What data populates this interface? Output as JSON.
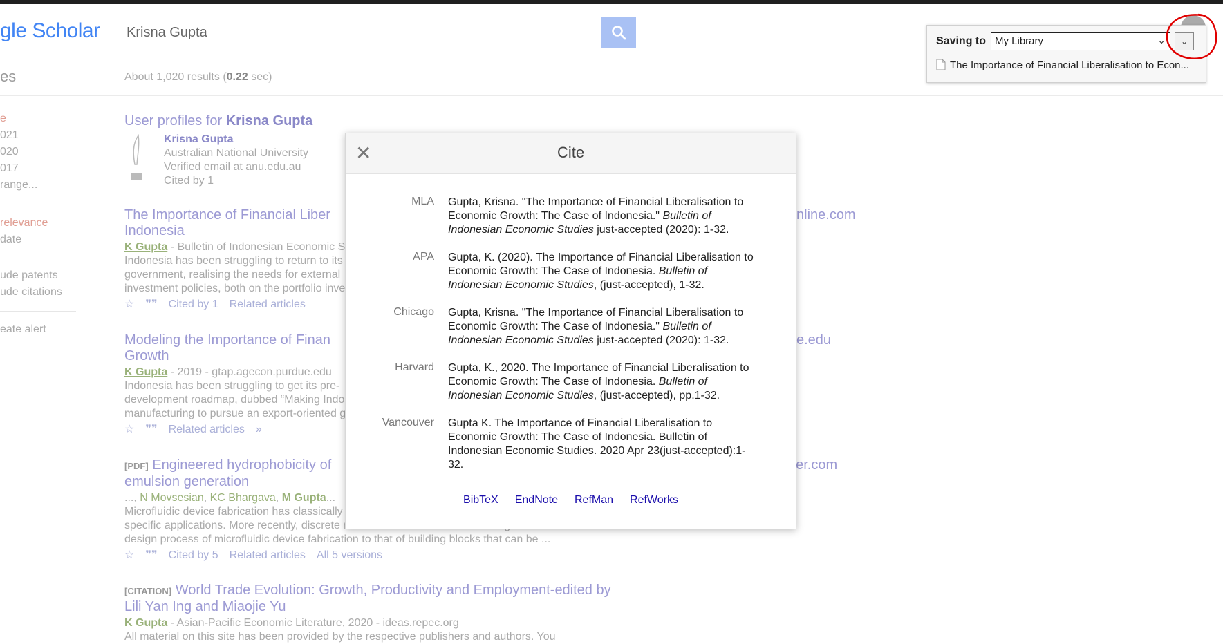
{
  "logo": {
    "text": "gle Scholar"
  },
  "search": {
    "value": "Krisna Gupta",
    "button_icon": "search-icon"
  },
  "results_count": {
    "prefix": "About 1,020 results (",
    "time": "0.22",
    "suffix": " sec)"
  },
  "sidebar": {
    "heading": "es",
    "time_filters": [
      "e",
      "021",
      "020",
      "017",
      " range..."
    ],
    "sort_options": [
      "relevance",
      "date"
    ],
    "include_options": [
      "ude patents",
      "ude citations"
    ],
    "alert": "eate alert"
  },
  "profiles": {
    "title_prefix": "User profiles for ",
    "title_name": "Krisna Gupta",
    "name": "Krisna Gupta",
    "affiliation": "Australian National University",
    "email": "Verified email at anu.edu.au",
    "cited_by": "Cited by 1"
  },
  "results": [
    {
      "title_line1": "The Importance of Financial Liber",
      "title_line2": "Indonesia",
      "author": "K Gupta",
      "meta_rest": " - Bulletin of Indonesian Economic S",
      "snippet": [
        "Indonesia has been struggling to return to its",
        "government, realising the needs for external",
        "investment policies, both on the portfolio inve"
      ],
      "actions": [
        "Cited by 1",
        "Related articles"
      ],
      "right_url": "nline.com"
    },
    {
      "title_line1": "Modeling the Importance of Finan",
      "title_line2": "Growth",
      "author": "K Gupta",
      "meta_rest": " - 2019 - gtap.agecon.purdue.edu",
      "snippet": [
        "Indonesia has been struggling to get its pre-",
        "development roadmap, dubbed “Making Indo",
        "manufacturing to pursue an export-oriented g"
      ],
      "actions": [
        "Related articles"
      ],
      "right_url": "e.edu"
    },
    {
      "tag": "[PDF]",
      "title_line1": "Engineered hydrophobicity of",
      "title_line2": "emulsion generation",
      "authors_line": [
        "...,",
        "N Movsesian",
        ",",
        "KC Bhargava",
        ",",
        "M Gupta",
        "..."
      ],
      "snippet": [
        "Microfluidic device fabrication has classically",
        "specific applications. More recently, discrete microfluidic elements have reimagined the",
        "design process of microfluidic device fabrication to that of building blocks that can be ..."
      ],
      "actions": [
        "Cited by 5",
        "Related articles",
        "All 5 versions"
      ],
      "right_url": "ger.com"
    },
    {
      "tag": "[CITATION]",
      "title_line1": "World Trade Evolution: Growth, Productivity and Employment-edited by",
      "title_line2": "Lili Yan Ing and Miaojie Yu",
      "author": "K Gupta",
      "meta_rest": " - Asian-Pacific Economic Literature, 2020 - ideas.repec.org",
      "snippet": [
        "All material on this site has been provided by the respective publishers and authors. You"
      ]
    }
  ],
  "cite_modal": {
    "title": "Cite",
    "entries": [
      {
        "style": "MLA",
        "lines": [
          "Gupta, Krisna. \"The Importance of Financial Liberalisation to",
          "Economic Growth: The Case of Indonesia.\" ",
          "Bulletin of",
          "Indonesian Economic Studies",
          " just-accepted (2020): 1-32."
        ]
      },
      {
        "style": "APA",
        "lines": [
          "Gupta, K. (2020). The Importance of Financial Liberalisation to",
          "Economic Growth: The Case of Indonesia. ",
          "Bulletin of",
          "Indonesian Economic Studies",
          ", (just-accepted), 1-32."
        ]
      },
      {
        "style": "Chicago",
        "lines": [
          "Gupta, Krisna. \"The Importance of Financial Liberalisation to",
          "Economic Growth: The Case of Indonesia.\" ",
          "Bulletin of",
          "Indonesian Economic Studies",
          " just-accepted (2020): 1-32."
        ]
      },
      {
        "style": "Harvard",
        "lines": [
          "Gupta, K., 2020. The Importance of Financial Liberalisation to",
          "Economic Growth: The Case of Indonesia. ",
          "Bulletin of",
          "Indonesian Economic Studies",
          ", (just-accepted), pp.1-32."
        ]
      },
      {
        "style": "Vancouver",
        "lines": [
          "Gupta K. The Importance of Financial Liberalisation to",
          "Economic Growth: The Case of Indonesia. Bulletin of",
          "Indonesian Economic Studies. 2020 Apr 23(just-accepted):1-",
          "32."
        ]
      }
    ],
    "export_links": [
      "BibTeX",
      "EndNote",
      "RefMan",
      "RefWorks"
    ]
  },
  "saving_panel": {
    "label": "Saving to",
    "selected": "My Library",
    "item": "The Importance of Financial Liberalisation to Econ..."
  },
  "colors": {
    "accent_link": "#1a0dab",
    "search_button": "#a9c1f4",
    "annotation": "#e00000"
  }
}
